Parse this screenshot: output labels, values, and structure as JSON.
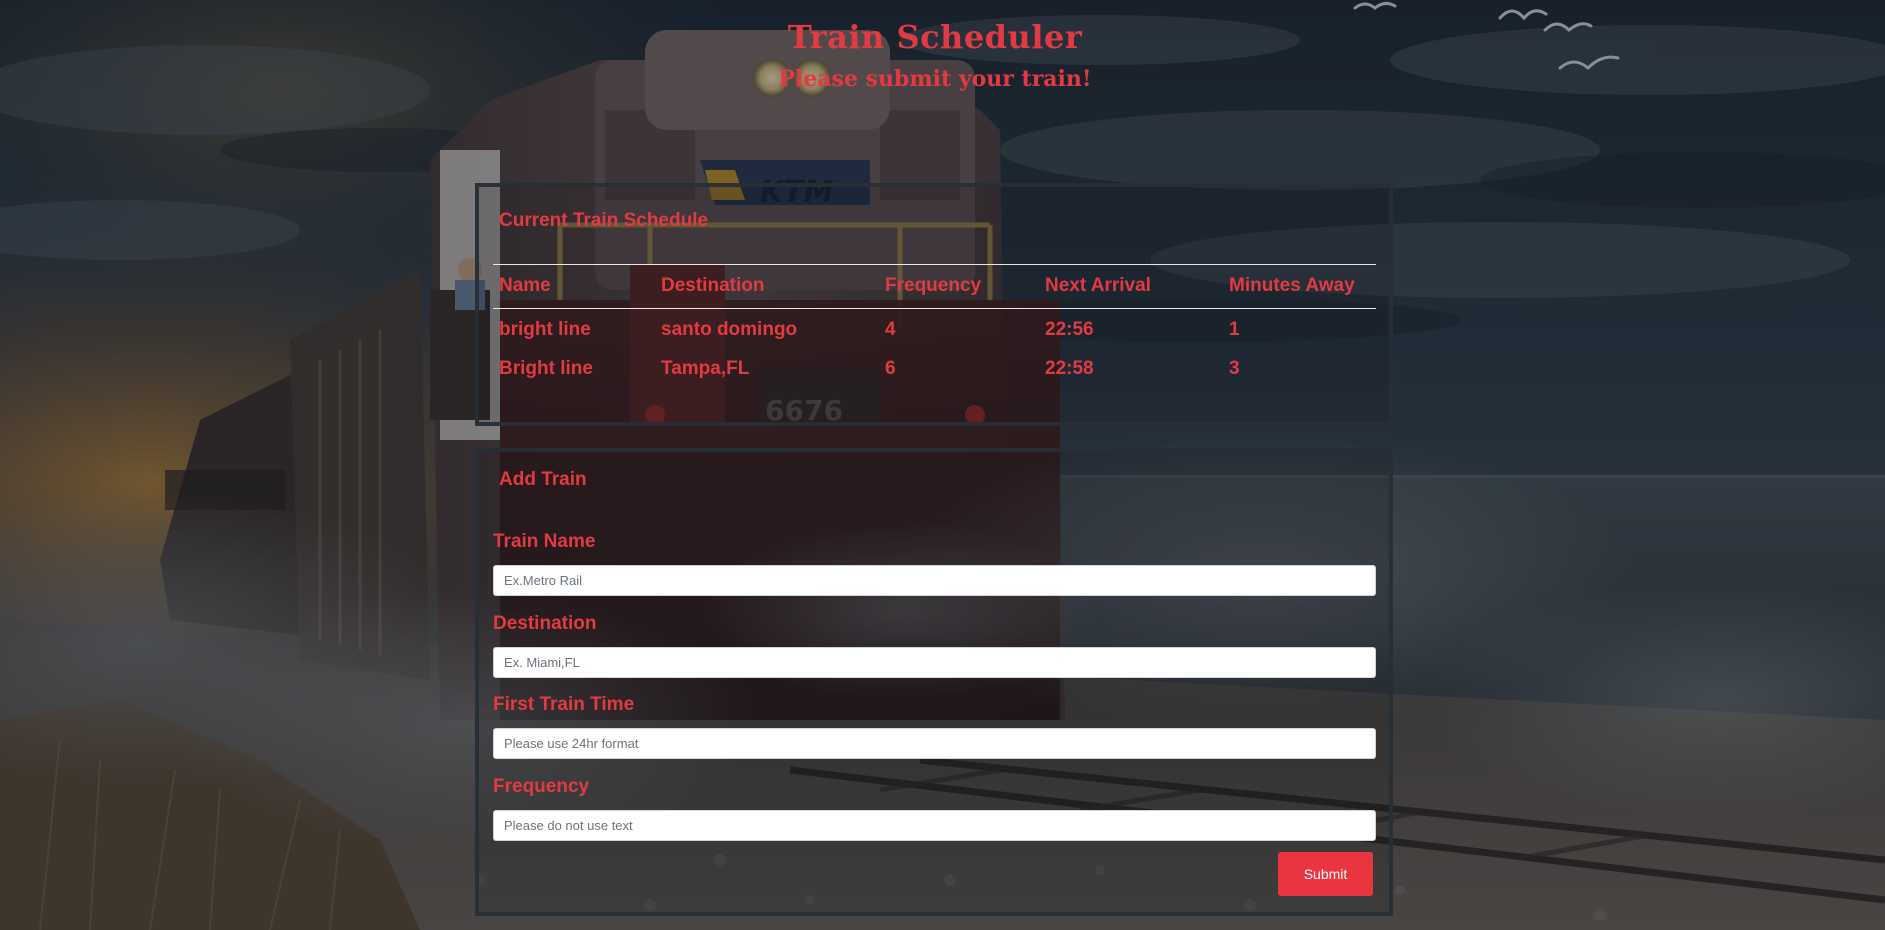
{
  "header": {
    "title": "Train Scheduler",
    "subtitle": "Please submit your train!"
  },
  "schedule": {
    "heading": "Current Train Schedule",
    "columns": [
      "Name",
      "Destination",
      "Frequency",
      "Next Arrival",
      "Minutes Away"
    ],
    "rows": [
      {
        "name": "bright line",
        "destination": "santo domingo",
        "frequency": "4",
        "next_arrival": "22:56",
        "minutes_away": "1"
      },
      {
        "name": "Bright line",
        "destination": "Tampa,FL",
        "frequency": "6",
        "next_arrival": "22:58",
        "minutes_away": "3"
      }
    ]
  },
  "add_train": {
    "heading": "Add Train",
    "fields": {
      "train_name": {
        "label": "Train Name",
        "placeholder": "Ex.Metro Rail",
        "value": ""
      },
      "destination": {
        "label": "Destination",
        "placeholder": "Ex. Miami,FL",
        "value": ""
      },
      "first_train_time": {
        "label": "First Train Time",
        "placeholder": "Please use 24hr format",
        "value": ""
      },
      "frequency": {
        "label": "Frequency",
        "placeholder": "Please do not use text",
        "value": ""
      }
    },
    "submit_label": "Submit"
  },
  "background": {
    "engine_logo": "KTM",
    "engine_number": "6676"
  },
  "colors": {
    "accent": "#e23a43",
    "button": "#e8353f",
    "panel_border": "#282e36"
  }
}
